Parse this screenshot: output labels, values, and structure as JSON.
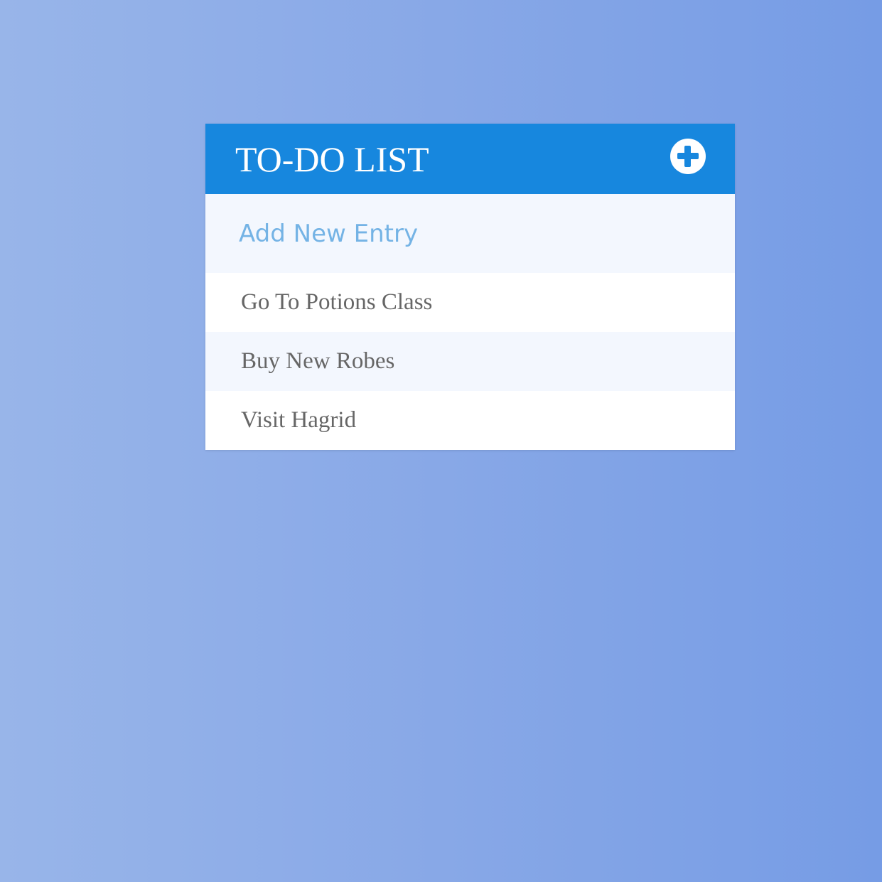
{
  "todo": {
    "title": "TO-DO LIST",
    "add_icon": "plus-circle-icon",
    "new_entry": {
      "placeholder": "Add New Entry",
      "value": ""
    },
    "items": [
      {
        "label": "Go To Potions Class"
      },
      {
        "label": "Buy New Robes"
      },
      {
        "label": "Visit Hagrid"
      }
    ]
  },
  "colors": {
    "header": "#1787de",
    "placeholder": "#74b3e5",
    "item_text": "#666666",
    "alt_row": "#f3f7fe",
    "background_start": "#98b5e9",
    "background_end": "#769ce5"
  }
}
